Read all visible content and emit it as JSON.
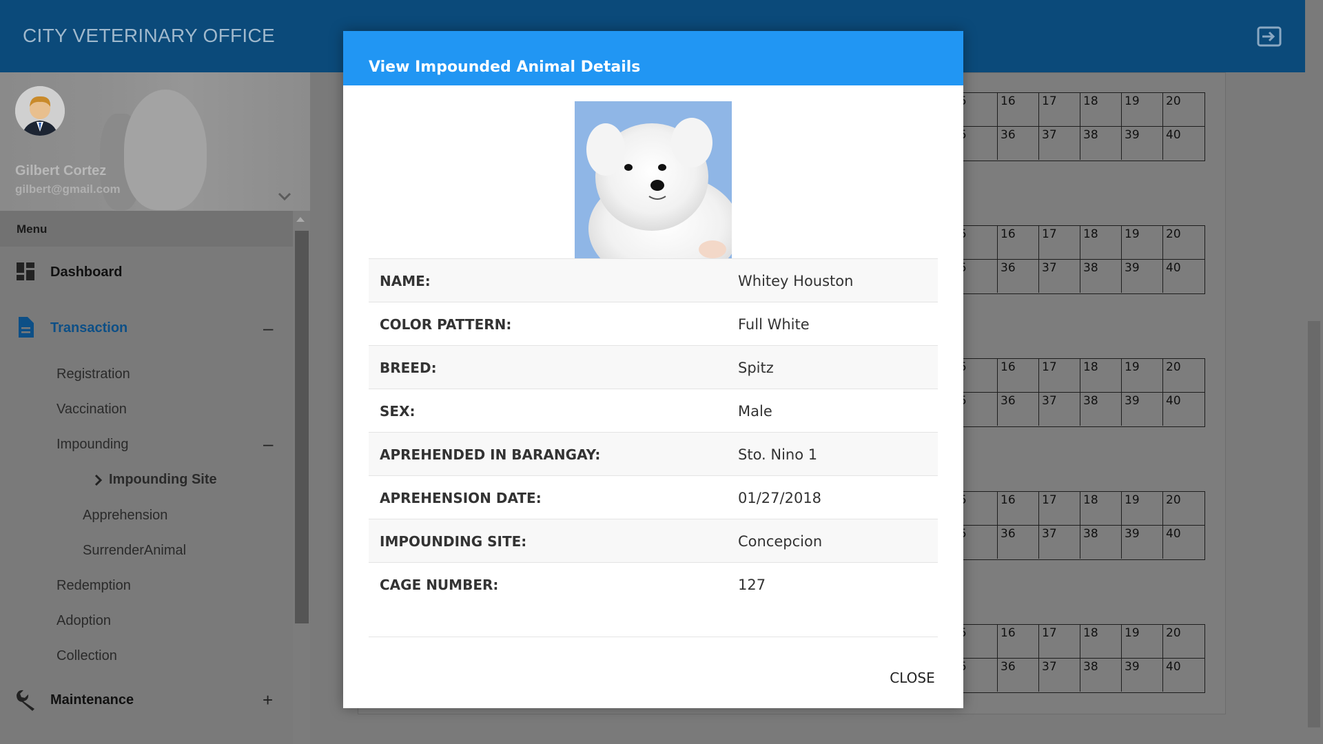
{
  "app": {
    "title": "CITY VETERINARY OFFICE"
  },
  "user": {
    "name": "Gilbert Cortez",
    "email": "gilbert@gmail.com"
  },
  "sidebar": {
    "menu_label": "Menu",
    "items": [
      {
        "label": "Dashboard"
      },
      {
        "label": "Transaction",
        "toggle": "–"
      },
      {
        "label": "Registration"
      },
      {
        "label": "Vaccination"
      },
      {
        "label": "Impounding",
        "toggle": "–"
      },
      {
        "label": "Impounding Site"
      },
      {
        "label": "Apprehension"
      },
      {
        "label": "SurrenderAnimal"
      },
      {
        "label": "Redemption"
      },
      {
        "label": "Adoption"
      },
      {
        "label": "Collection"
      },
      {
        "label": "Maintenance",
        "toggle": "+"
      }
    ]
  },
  "background_grid": {
    "row1": [
      "5",
      "16",
      "17",
      "18",
      "19",
      "20"
    ],
    "row2": [
      "5",
      "36",
      "37",
      "38",
      "39",
      "40"
    ]
  },
  "modal": {
    "title": "View Impounded Animal Details",
    "close_label": "CLOSE",
    "details": [
      {
        "label": "NAME:",
        "value": "Whitey Houston"
      },
      {
        "label": "COLOR PATTERN:",
        "value": "Full White"
      },
      {
        "label": "BREED:",
        "value": "Spitz"
      },
      {
        "label": "SEX:",
        "value": "Male"
      },
      {
        "label": "APREHENDED IN BARANGAY:",
        "value": "Sto. Nino 1"
      },
      {
        "label": "APREHENSION DATE:",
        "value": "01/27/2018"
      },
      {
        "label": "IMPOUNDING SITE:",
        "value": "Concepcion"
      },
      {
        "label": "CAGE NUMBER:",
        "value": "127"
      }
    ]
  },
  "colors": {
    "topbar": "#0b4a7a",
    "modal_header": "#2196f3",
    "active_nav": "#0d4f86"
  },
  "icons": [
    "logout-icon",
    "dashboard-icon",
    "document-icon",
    "chevron-right-icon",
    "wrench-icon",
    "chevron-down-icon"
  ]
}
